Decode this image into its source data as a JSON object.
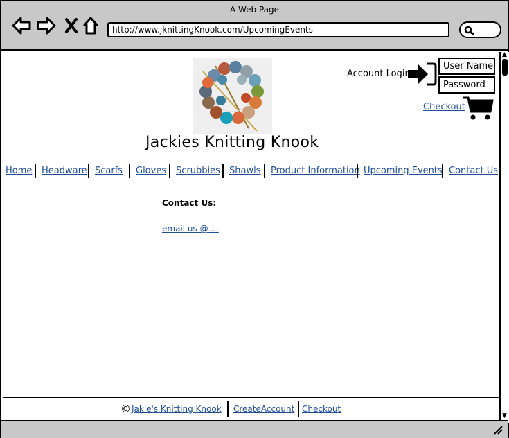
{
  "window": {
    "title": "A Web Page",
    "url": "http://www.jknittingKnook.com/UpcomingEvents"
  },
  "icons": {
    "back": "back-arrow-icon",
    "forward": "forward-arrow-icon",
    "stop": "close-icon",
    "home": "home-icon",
    "search": "search-icon",
    "login": "login-arrow-icon",
    "cart": "shopping-cart-icon"
  },
  "site": {
    "title": "Jackies Knitting Knook"
  },
  "account": {
    "login_label": "Account Login",
    "username_placeholder": "User Name",
    "password_placeholder": "Password",
    "checkout": "Checkout"
  },
  "nav": {
    "items": [
      {
        "label": "Home"
      },
      {
        "label": "Headware"
      },
      {
        "label": "Scarfs"
      },
      {
        "label": "Gloves"
      },
      {
        "label": "Scrubbies"
      },
      {
        "label": "Shawls"
      },
      {
        "label": "Product Information"
      },
      {
        "label": "Upcoming Events"
      },
      {
        "label": "Contact Us"
      }
    ]
  },
  "main": {
    "heading": "Contact Us:",
    "email_link": "email us @ ..."
  },
  "footer": {
    "copyright_symbol": "©",
    "links": [
      "Jakie's Knitting Knook",
      "CreateAccount",
      "Checkout"
    ]
  },
  "colors": {
    "link": "#1f4e9b",
    "chrome": "#c8c8c8"
  }
}
